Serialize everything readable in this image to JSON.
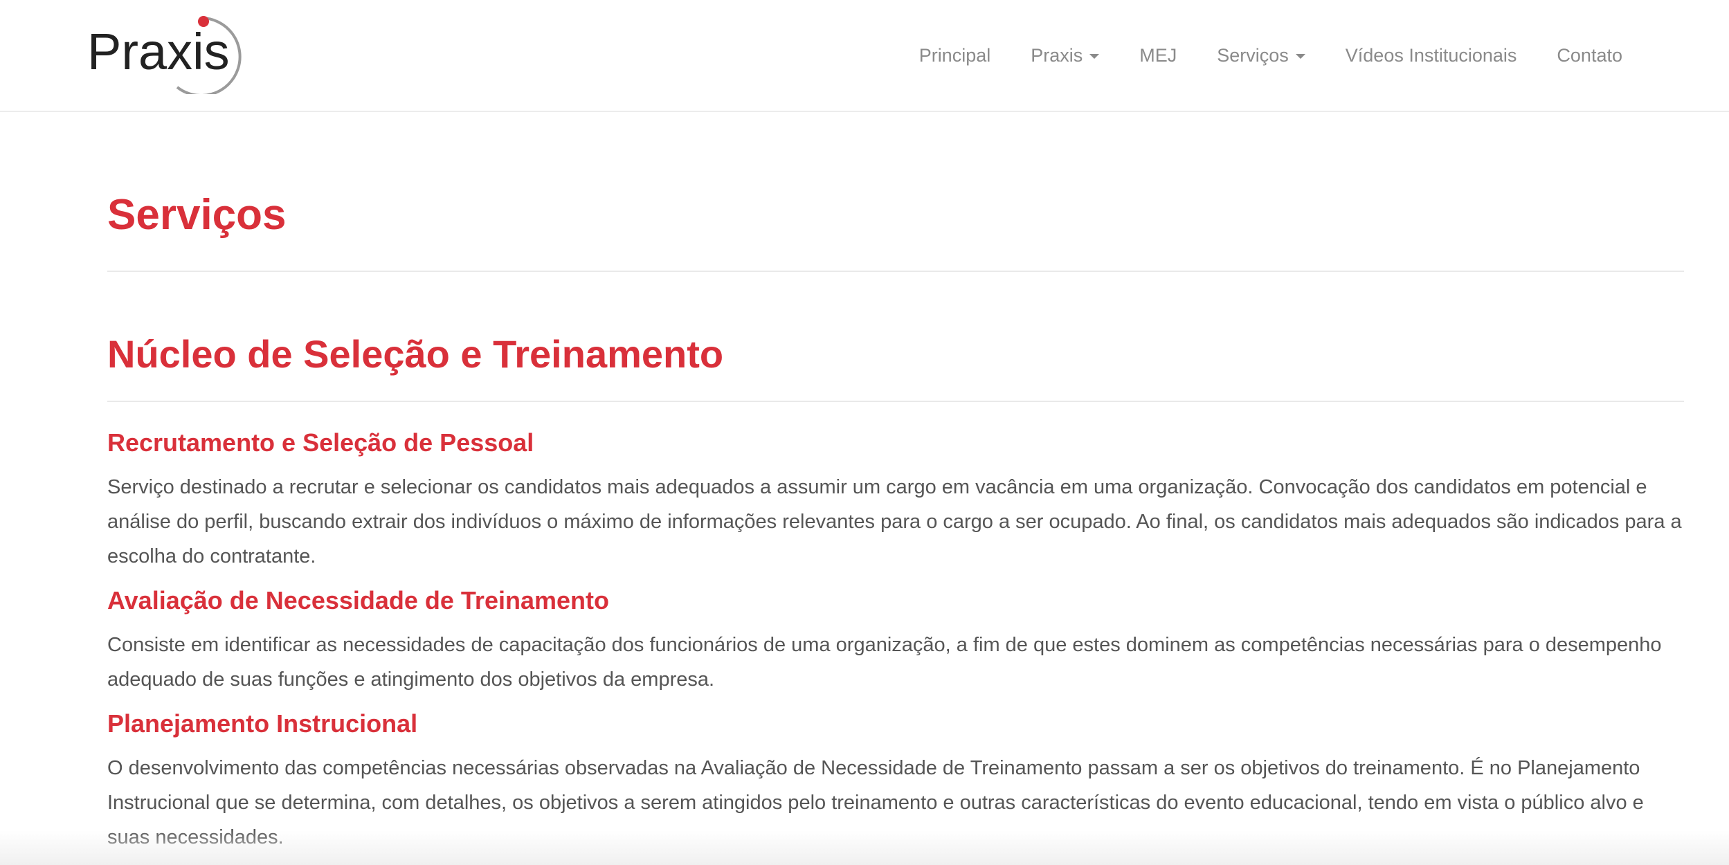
{
  "brand": {
    "name": "Praxis",
    "accent_color": "#d9303a"
  },
  "nav": {
    "items": [
      {
        "label": "Principal",
        "dropdown": false
      },
      {
        "label": "Praxis",
        "dropdown": true
      },
      {
        "label": "MEJ",
        "dropdown": false
      },
      {
        "label": "Serviços",
        "dropdown": true
      },
      {
        "label": "Vídeos Institucionais",
        "dropdown": false
      },
      {
        "label": "Contato",
        "dropdown": false
      }
    ]
  },
  "page": {
    "title": "Serviços",
    "section_title": "Núcleo de Seleção e Treinamento",
    "services": [
      {
        "title": "Recrutamento e Seleção de Pessoal",
        "description": "Serviço destinado a recrutar e selecionar os candidatos mais adequados a assumir um cargo em vacância em uma organização. Convocação dos candidatos em potencial e análise do perfil, buscando extrair dos indivíduos o máximo de informações relevantes para o cargo a ser ocupado. Ao final, os candidatos mais adequados são indicados para a escolha do contratante."
      },
      {
        "title": "Avaliação de Necessidade de Treinamento",
        "description": "Consiste em identificar as necessidades de capacitação dos funcionários de uma organização, a fim de que estes dominem as competências necessárias para o desempenho adequado de suas funções e atingimento dos objetivos da empresa."
      },
      {
        "title": "Planejamento Instrucional",
        "description": "O desenvolvimento das competências necessárias observadas na Avaliação de Necessidade de Treinamento passam a ser os objetivos do treinamento. É no Planejamento Instrucional que se determina, com detalhes, os objetivos a serem atingidos pelo treinamento e outras características do evento educacional, tendo em vista o público alvo e suas necessidades."
      }
    ]
  }
}
